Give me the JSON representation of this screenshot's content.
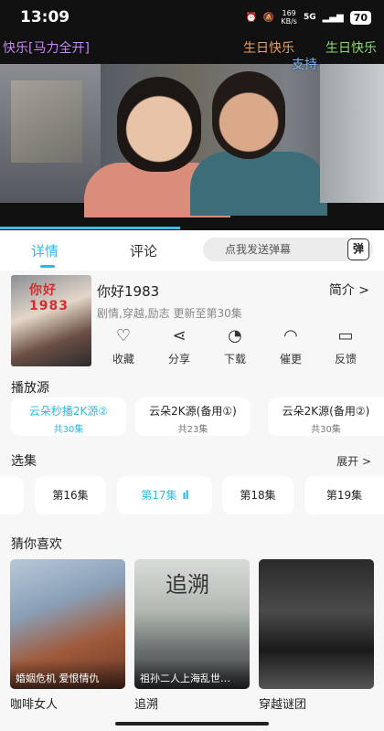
{
  "status_bar": {
    "time": "13:09",
    "net_speed": "169",
    "net_unit": "KB/s",
    "signal": "5G",
    "battery": "70"
  },
  "danmu": [
    {
      "text": "快乐[马力全开]",
      "color": "#c78af2"
    },
    {
      "text": "生日快乐",
      "color": "#f0a060"
    },
    {
      "text": "生日快乐",
      "color": "#8ee06a"
    },
    {
      "text": "支持",
      "color": "#7ab8f5"
    }
  ],
  "playback_progress": 0.47,
  "tabs": {
    "detail": "详情",
    "comments": "评论"
  },
  "danmu_input": {
    "placeholder": "点我发送弹幕",
    "send_label": "弹"
  },
  "show": {
    "poster_title": "你好1983",
    "title": "你好1983",
    "meta": "剧情,穿越,励志 更新至第30集",
    "intro_label": "简介 >"
  },
  "actions": [
    {
      "label": "收藏",
      "icon": "heart-icon",
      "glyph": "♡"
    },
    {
      "label": "分享",
      "icon": "share-icon",
      "glyph": "⋖"
    },
    {
      "label": "下载",
      "icon": "download-icon",
      "glyph": "◔"
    },
    {
      "label": "催更",
      "icon": "bell-icon",
      "glyph": "◠"
    },
    {
      "label": "反馈",
      "icon": "feedback-icon",
      "glyph": "▭"
    }
  ],
  "sources": {
    "title": "播放源",
    "items": [
      {
        "name": "云朵秒播2K源②",
        "count": "共30集",
        "active": true
      },
      {
        "name": "云朵2K源(备用①)",
        "count": "共23集",
        "active": false
      },
      {
        "name": "云朵2K源(备用②)",
        "count": "共30集",
        "active": false
      }
    ]
  },
  "episodes": {
    "title": "选集",
    "expand_label": "展开 >",
    "items": [
      {
        "label": "第16集",
        "active": false
      },
      {
        "label": "第17集",
        "active": true
      },
      {
        "label": "第18集",
        "active": false
      },
      {
        "label": "第19集",
        "active": false
      }
    ],
    "playing_glyph": "ıl"
  },
  "recommend": {
    "title": "猜你喜欢",
    "items": [
      {
        "caption": "婚姻危机 爱恨情仇",
        "name": "咖啡女人",
        "poster_text": ""
      },
      {
        "caption": "祖孙二人上海乱世…",
        "name": "追溯",
        "poster_text": "追溯"
      },
      {
        "caption": "",
        "name": "穿越谜团",
        "poster_text": ""
      }
    ]
  }
}
